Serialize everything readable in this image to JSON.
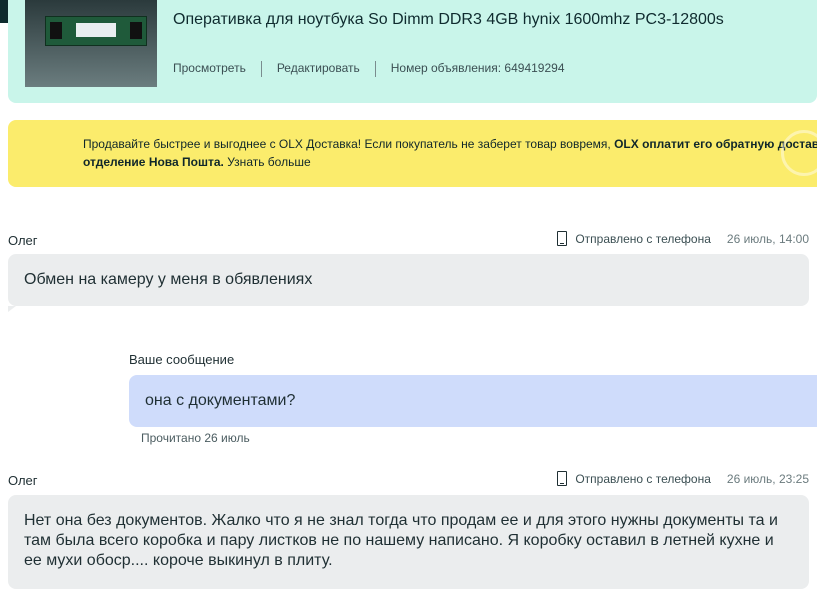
{
  "ad": {
    "title": "Оперативка для ноутбука So Dimm DDR3 4GB hynix 1600mhz PC3-12800s",
    "view_label": "Просмотреть",
    "edit_label": "Редактировать",
    "ad_number": "Номер объявления: 649419294"
  },
  "promo": {
    "text_normal": "Продавайте быстрее и выгоднее с OLX Доставка! Если покупатель не заберет товар вовремя, ",
    "text_bold_1": "OLX оплатит его обратную доставку",
    "text_bold_2": "отделение Нова Пошта.",
    "link": "Узнать больше"
  },
  "messages": [
    {
      "sender": "Олег",
      "device": "Отправлено с телефона",
      "time": "26 июль, 14:00",
      "text": "Обмен на камеру у меня в обявлениях"
    },
    {
      "label": "Ваше сообщение",
      "text": "она с документами?",
      "status": "Прочитано 26 июль"
    },
    {
      "sender": "Олег",
      "device": "Отправлено с телефона",
      "time": "26 июль, 23:25",
      "text": "Нет она без документов. Жалко что я не знал тогда что продам ее и для этого нужны документы та и там была всего коробка и пару листков не по нашему написано. Я коробку оставил в летней кухне и ее мухи обоср.... короче выкинул в плиту."
    }
  ],
  "icons": {
    "phone": "phone-icon"
  },
  "colors": {
    "ad_card_bg": "#c9f5ea",
    "promo_bg": "#fbec6c",
    "incoming_bubble": "#ebedee",
    "outgoing_bubble": "#cfdcfb",
    "topbar": "#0e2b2e"
  }
}
